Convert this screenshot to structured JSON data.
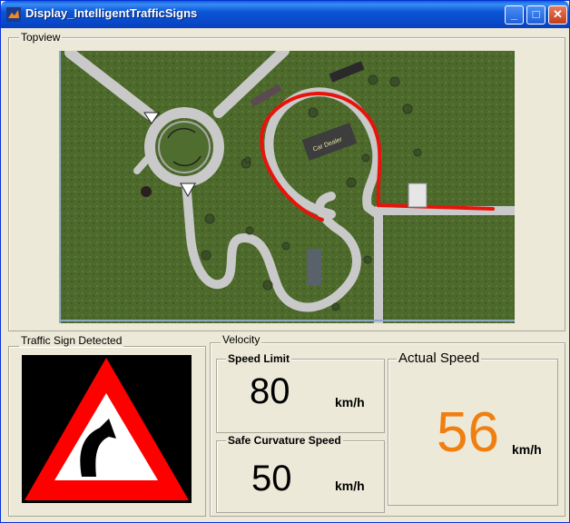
{
  "window": {
    "title": "Display_IntelligentTrafficSigns",
    "buttons": {
      "minimize": "_",
      "maximize": "□",
      "close": "✕"
    }
  },
  "topview": {
    "label": "Topview",
    "sign_label": "Car Dealer"
  },
  "traffic_sign": {
    "label": "Traffic Sign Detected",
    "sign_type": "curve-right-warning"
  },
  "velocity": {
    "label": "Velocity",
    "speed_limit": {
      "label": "Speed Limit",
      "value": "80",
      "unit": "km/h"
    },
    "safe_curvature": {
      "label": "Safe Curvature Speed",
      "value": "50",
      "unit": "km/h"
    },
    "actual": {
      "label": "Actual Speed",
      "value": "56",
      "unit": "km/h",
      "color": "#f07f10"
    }
  },
  "colors": {
    "grass": "#4d6a2c",
    "road": "#c9c9c9",
    "route": "#e8140c",
    "sign_border": "#ff0000"
  }
}
